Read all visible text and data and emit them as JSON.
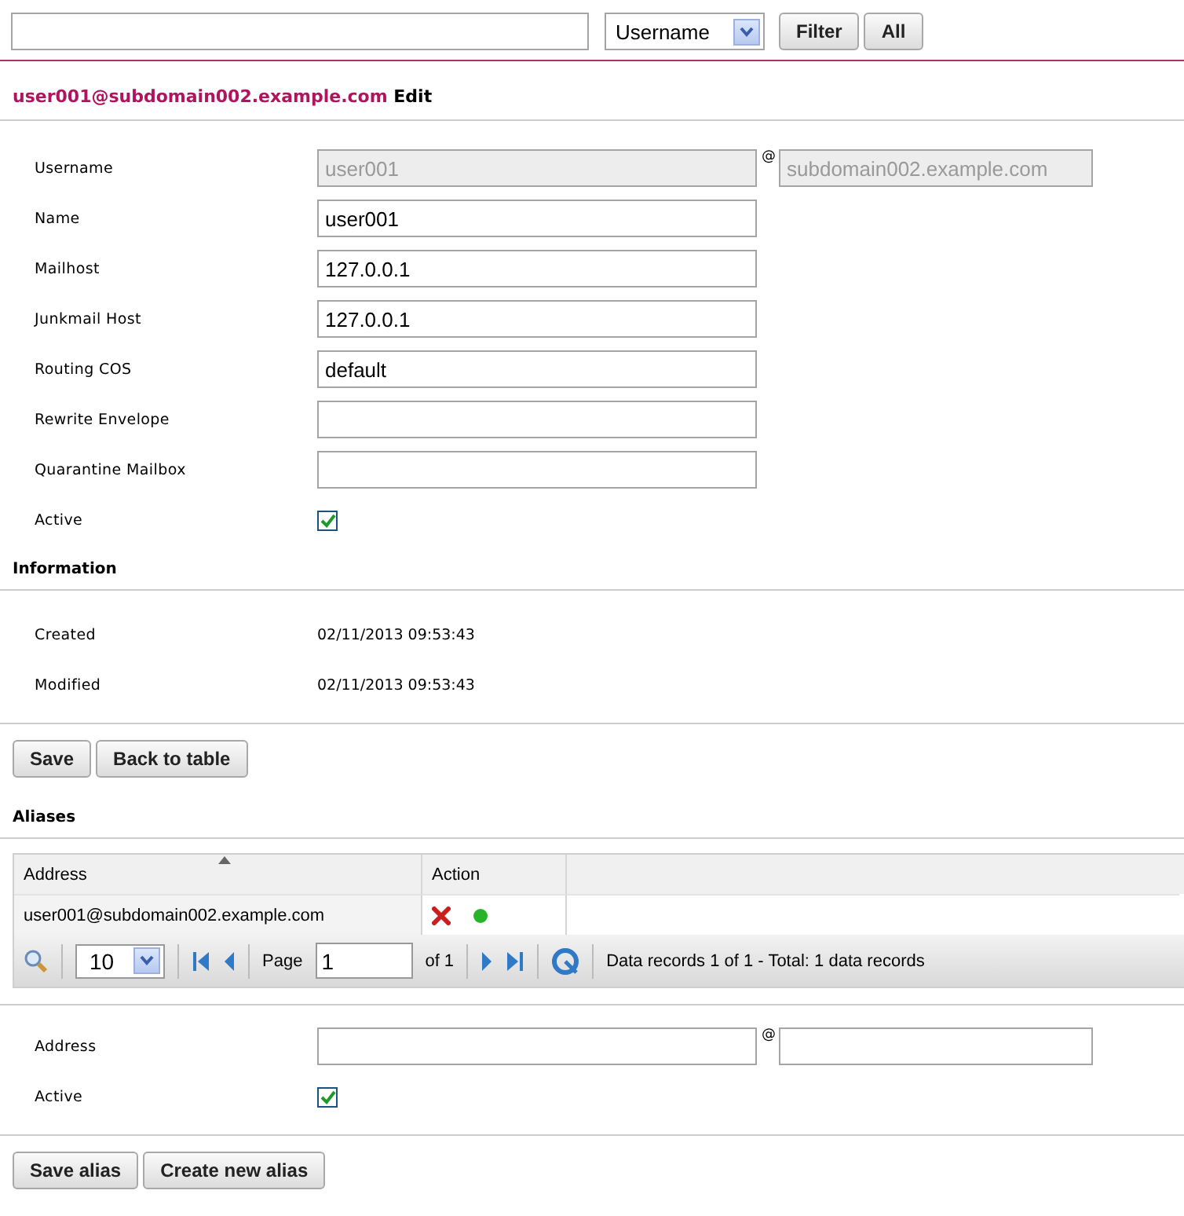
{
  "filter": {
    "field": "Username",
    "buttons": [
      "Filter",
      "All"
    ]
  },
  "title": {
    "address": "user001@subdomain002.example.com",
    "suffix": "Edit"
  },
  "fields": [
    {
      "kind": "split",
      "label": "Username",
      "value": "user001",
      "at": "@",
      "domain": "subdomain002.example.com",
      "disabled": true
    },
    {
      "kind": "text",
      "label": "Name",
      "value": "user001",
      "disabled": false
    },
    {
      "kind": "text",
      "label": "Mailhost",
      "value": "127.0.0.1",
      "disabled": false
    },
    {
      "kind": "text",
      "label": "Junkmail Host",
      "value": "127.0.0.1",
      "disabled": false
    },
    {
      "kind": "text",
      "label": "Routing COS",
      "value": "default",
      "disabled": false
    },
    {
      "kind": "text",
      "label": "Rewrite Envelope",
      "disabled": false
    },
    {
      "kind": "text",
      "label": "Quarantine Mailbox",
      "disabled": false
    },
    {
      "kind": "checkbox",
      "label": "Active",
      "checked": true
    }
  ],
  "information": {
    "heading": "Information",
    "rows": [
      {
        "label": "Created",
        "value": "02/11/2013 09:53:43"
      },
      {
        "label": "Modified",
        "value": "02/11/2013 09:53:43"
      }
    ]
  },
  "form_buttons": [
    "Save",
    "Back to table"
  ],
  "aliases": {
    "heading": "Aliases",
    "columns": [
      {
        "label": "Address",
        "sorted": true
      },
      {
        "label": "Action",
        "sorted": false
      }
    ],
    "rows": [
      {
        "address": "user001@subdomain002.example.com",
        "active": true
      }
    ],
    "pager": {
      "page_size": "10",
      "page_label": "Page",
      "page": "1",
      "of": "of 1",
      "summary": "Data records 1 of 1 - Total: 1 data records"
    }
  },
  "alias_form": [
    {
      "kind": "split",
      "label": "Address",
      "at": "@",
      "disabled": false
    },
    {
      "kind": "checkbox",
      "label": "Active",
      "checked": true
    }
  ],
  "alias_buttons": [
    "Save alias",
    "Create new alias"
  ]
}
